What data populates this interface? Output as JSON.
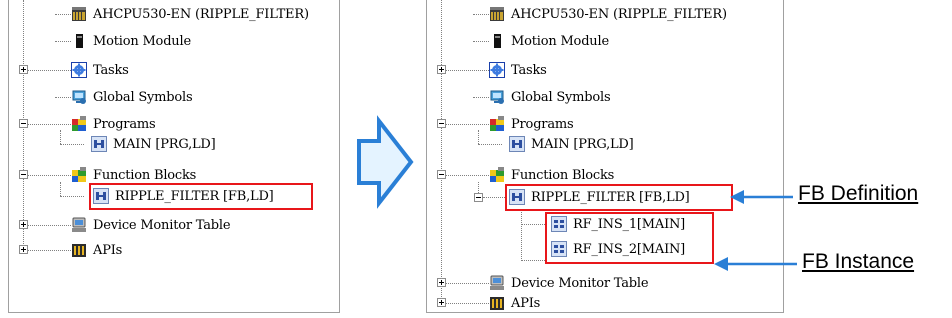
{
  "left_tree": {
    "items": [
      {
        "label": "AHCPU530-EN  (RIPPLE_FILTER)",
        "icon": "cpu-icon"
      },
      {
        "label": "Motion Module",
        "icon": "motion-module-icon"
      },
      {
        "label": "Tasks",
        "icon": "tasks-icon"
      },
      {
        "label": "Global Symbols",
        "icon": "global-symbols-icon"
      },
      {
        "label": "Programs",
        "icon": "programs-icon"
      },
      {
        "label": "MAIN [PRG,LD]",
        "icon": "program-item-icon"
      },
      {
        "label": "Function Blocks",
        "icon": "function-blocks-icon"
      },
      {
        "label": "RIPPLE_FILTER [FB,LD]",
        "icon": "function-block-item-icon"
      },
      {
        "label": "Device Monitor Table",
        "icon": "device-monitor-icon"
      },
      {
        "label": "APIs",
        "icon": "apis-icon"
      }
    ]
  },
  "right_tree": {
    "items": [
      {
        "label": "AHCPU530-EN  (RIPPLE_FILTER)",
        "icon": "cpu-icon"
      },
      {
        "label": "Motion Module",
        "icon": "motion-module-icon"
      },
      {
        "label": "Tasks",
        "icon": "tasks-icon"
      },
      {
        "label": "Global Symbols",
        "icon": "global-symbols-icon"
      },
      {
        "label": "Programs",
        "icon": "programs-icon"
      },
      {
        "label": "MAIN [PRG,LD]",
        "icon": "program-item-icon"
      },
      {
        "label": "Function Blocks",
        "icon": "function-blocks-icon"
      },
      {
        "label": "RIPPLE_FILTER [FB,LD]",
        "icon": "function-block-item-icon"
      },
      {
        "label": "RF_INS_1[MAIN]",
        "icon": "fb-instance-icon"
      },
      {
        "label": "RF_INS_2[MAIN]",
        "icon": "fb-instance-icon"
      },
      {
        "label": "Device Monitor Table",
        "icon": "device-monitor-icon"
      },
      {
        "label": "APIs",
        "icon": "apis-icon"
      }
    ]
  },
  "callouts": {
    "definition": "FB Definition",
    "instance": "FB Instance"
  },
  "colors": {
    "highlight": "#e8161a",
    "arrow": "#2a7fd6",
    "arrow_fill": "#e4f3ff"
  }
}
